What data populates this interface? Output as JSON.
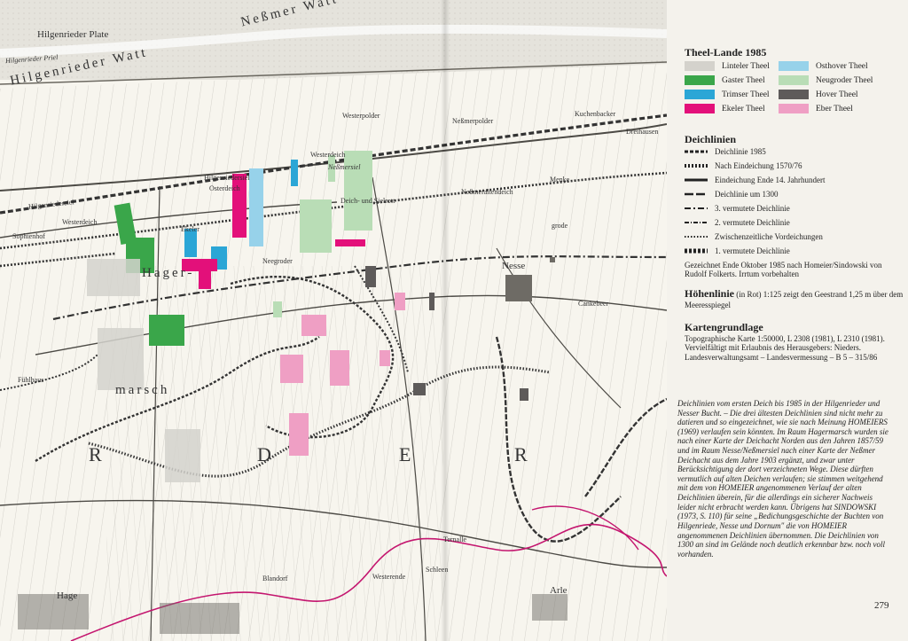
{
  "map": {
    "labels": {
      "hilgenrieder_plate": "Hilgenrieder Plate",
      "hilgenrieder_watt": "Hilgenrieder Watt",
      "nessmer_watt": "Neßmer Watt",
      "hilgenrieder_priel": "Hilgenrieder Priel",
      "hilgenriedersiel": "Hilgenriedersiel",
      "sophienhof": "Sophienhof",
      "westerdeich": "Westerdeich",
      "nessmersiel": "Neßmersiel",
      "westerdeich2": "Westerdeich",
      "nessmeraltendeich": "Neßmeraltendeich",
      "deich_und_sielrott": "Deich- und Sielrott",
      "westerpolder": "Westerpolder",
      "nessmerpolder": "Neßmerpolder",
      "kuchenbacker": "Kuchenbacker",
      "dreihausen": "Dreihausen",
      "ekeler": "Ekeler",
      "neegroder": "Neegroder",
      "hager": "Hager-",
      "marsch": "marsch",
      "nesse": "Nesse",
      "cankebeer": "Cankebeer",
      "hage": "Hage",
      "westerende": "Westerende",
      "blandorf": "Blandorf",
      "arle": "Arle",
      "schleen": "Schleen",
      "ternalle": "Ternalle",
      "grode": "grode",
      "menke": "Menke",
      "fuhlhaus": "Fühlhaus",
      "d1": "R",
      "d2": "D",
      "d3": "E",
      "d4": "R",
      "heiligenthal": "Hilgenriedersiel",
      "osterdeich": "Osterdeich"
    }
  },
  "legend": {
    "theel_title": "Theel-Lande 1985",
    "theel_items": [
      {
        "label": "Linteler Theel",
        "color": "#d4d2cc"
      },
      {
        "label": "Gaster Theel",
        "color": "#3aa64a"
      },
      {
        "label": "Trimser Theel",
        "color": "#2ba6d6"
      },
      {
        "label": "Ekeler Theel",
        "color": "#e3107a"
      },
      {
        "label": "Osthover Theel",
        "color": "#97d2ea"
      },
      {
        "label": "Neugroder Theel",
        "color": "#b9ddb6"
      },
      {
        "label": "Hover Theel",
        "color": "#5e5b5a"
      },
      {
        "label": "Eber Theel",
        "color": "#ef9fc4"
      }
    ],
    "deich_title": "Deichlinien",
    "deich_items": [
      "Deichlinie 1985",
      "Nach Eindeichung 1570/76",
      "Eindeichung Ende 14. Jahrhundert",
      "Deichlinie um 1300",
      "3. vermutete Deichlinie",
      "2. vermutete Deichlinie",
      "Zwischenzeitliche Vordeichungen",
      "1. vermutete Deichlinie"
    ],
    "deich_note": "Gezeichnet Ende Oktober 1985 nach Homeier/Sindowski von Rudolf Folkerts. Irrtum vorbehalten",
    "hoehen_title": "Höhenlinie",
    "hoehen_sub": "(in Rot)",
    "hoehen_text": "1:125 zeigt den Geestrand 1,25 m über dem Meeresspiegel",
    "karten_title": "Kartengrundlage",
    "karten_text": "Topographische Karte 1:50000, L 2308 (1981), L 2310 (1981). Vervielfältigt mit Erlaubnis des Herausgebers: Nieders. Landesverwaltungsamt – Landesvermessung – B 5 – 315/86",
    "paragraph": "Deichlinien vom ersten Deich bis 1985 in der Hilgenrieder und Nesser Bucht. – Die drei ältesten Deichlinien sind nicht mehr zu datieren und so eingezeichnet, wie sie nach Meinung HOMEIERS (1969) verlaufen sein könnten. Im Raum Hagermarsch wurden sie nach einer Karte der Deichacht Norden aus den Jahren 1857/59 und im Raum Nesse/Neßmersiel nach einer Karte der Neßmer Deichacht aus dem Jahre 1903 ergänzt, und zwar unter Berücksichtigung der dort verzeichneten Wege. Diese dürften vermutlich auf alten Deichen verlaufen; sie stimmen weitgehend mit dem von HOMEIER angenommenen Verlauf der alten Deichlinien überein, für die allerdings ein sicherer Nachweis leider nicht erbracht werden kann. Übrigens hat SINDOWSKI (1973, S. 110) für seine „Bedichungsgeschichte der Buchten von Hilgenriede, Nesse und Dornum\" die von HOMEIER angenommenen Deichlinien übernommen. Die Deichlinien von 1300 an sind im Gelände noch deutlich erkennbar bzw. noch voll vorhanden.",
    "page_number": "279"
  }
}
